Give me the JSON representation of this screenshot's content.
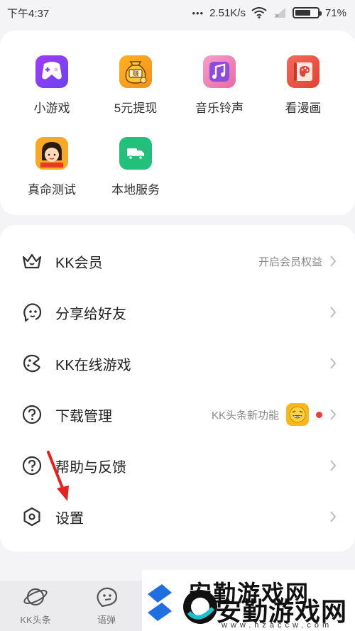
{
  "status_bar": {
    "time": "下午4:37",
    "dots": "•••",
    "speed": "2.51K/s",
    "battery": "71%",
    "battery_level": 0.71
  },
  "apps": [
    {
      "label": "小游戏",
      "icon": "gamepad-icon",
      "color": "#7b3ff5"
    },
    {
      "label": "5元提现",
      "icon": "money-bag-icon",
      "color": "#f7a21b"
    },
    {
      "label": "音乐铃声",
      "icon": "music-note-icon",
      "color": "#f07ab0"
    },
    {
      "label": "看漫画",
      "icon": "palette-book-icon",
      "color": "#f05a4a"
    },
    {
      "label": "真命测试",
      "icon": "avatar-test-icon",
      "color": "#f5a623"
    },
    {
      "label": "本地服务",
      "icon": "delivery-truck-icon",
      "color": "#22c07a"
    }
  ],
  "menu": [
    {
      "label": "KK会员",
      "icon": "crown-icon",
      "hint": "开启会员权益"
    },
    {
      "label": "分享给好友",
      "icon": "share-face-icon",
      "hint": ""
    },
    {
      "label": "KK在线游戏",
      "icon": "game-face-icon",
      "hint": ""
    },
    {
      "label": "下载管理",
      "icon": "question-circle-icon",
      "hint": "KK头条新功能"
    },
    {
      "label": "帮助与反馈",
      "icon": "question-circle-icon",
      "hint": ""
    },
    {
      "label": "设置",
      "icon": "hexagon-settings-icon",
      "hint": ""
    }
  ],
  "bottom_nav": [
    {
      "label": "KK头条",
      "icon": "planet-icon"
    },
    {
      "label": "语弹",
      "icon": "chat-face-icon"
    }
  ],
  "watermark": {
    "title": "安勤游戏网",
    "url": "www.hzaccw.com"
  },
  "colors": {
    "background": "#f4f4f6",
    "card": "#ffffff",
    "red_dot": "#f03c3c",
    "arrow": "#e8201e"
  }
}
